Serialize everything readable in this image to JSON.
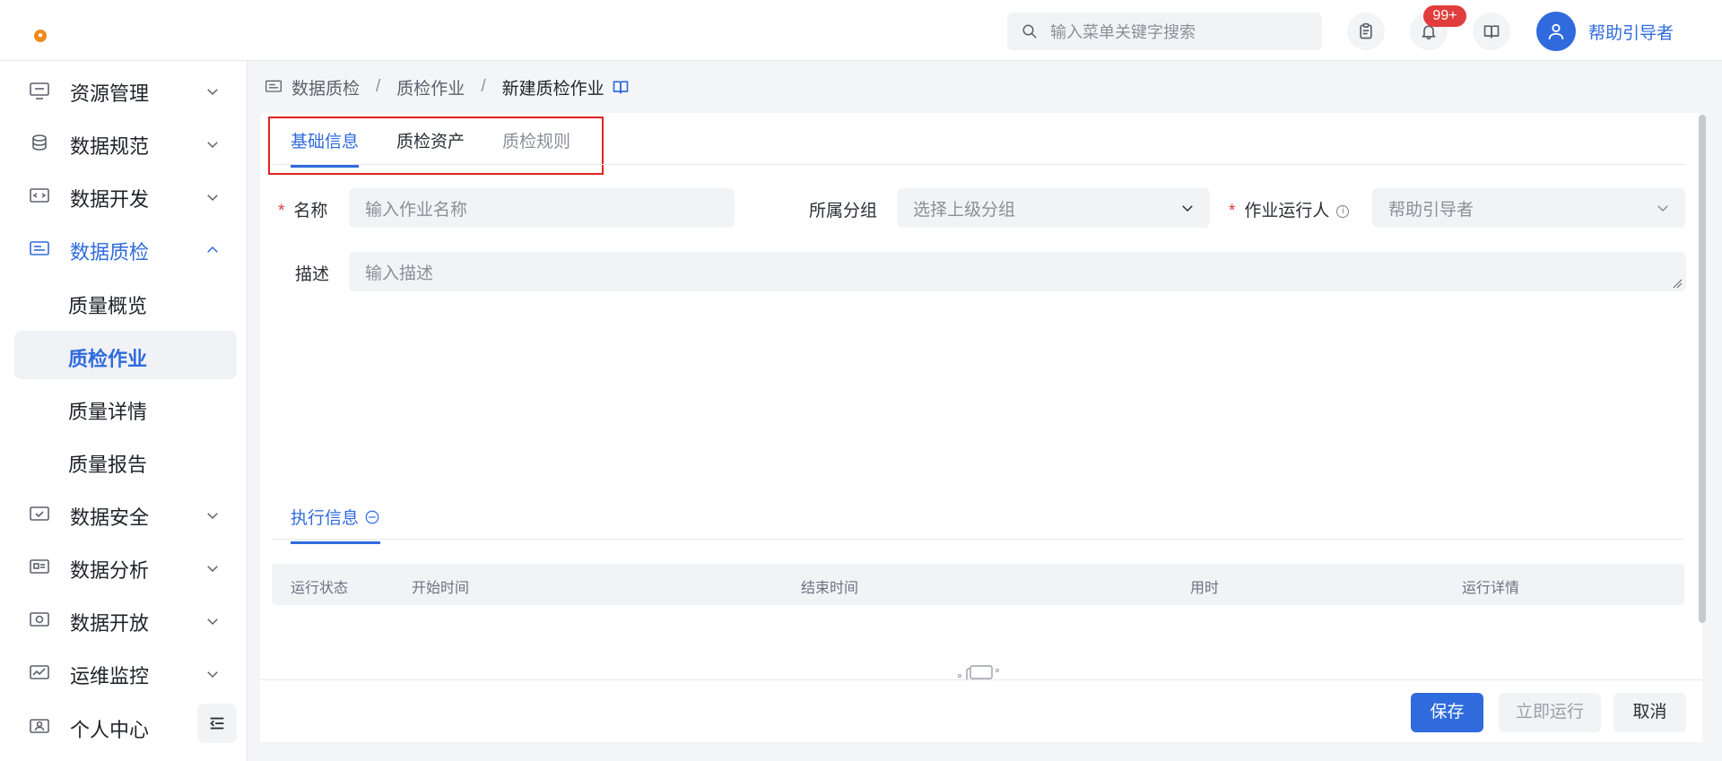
{
  "header": {
    "search_placeholder": "输入菜单关键字搜索",
    "notification_badge": "99+",
    "username": "帮助引导者"
  },
  "sidebar": {
    "items": [
      {
        "label": "资源管理"
      },
      {
        "label": "数据规范"
      },
      {
        "label": "数据开发"
      },
      {
        "label": "数据质检"
      },
      {
        "label": "数据安全"
      },
      {
        "label": "数据分析"
      },
      {
        "label": "数据开放"
      },
      {
        "label": "运维监控"
      },
      {
        "label": "个人中心"
      }
    ],
    "subitems": [
      {
        "label": "质量概览"
      },
      {
        "label": "质检作业"
      },
      {
        "label": "质量详情"
      },
      {
        "label": "质量报告"
      }
    ]
  },
  "breadcrumb": {
    "items": [
      "数据质检",
      "质检作业",
      "新建质检作业"
    ],
    "separator": "/"
  },
  "tabs": {
    "basic": "基础信息",
    "assets": "质检资产",
    "rules": "质检规则"
  },
  "form": {
    "required_mark": "*",
    "name_label": "名称",
    "name_placeholder": "输入作业名称",
    "group_label": "所属分组",
    "group_placeholder": "选择上级分组",
    "runner_label": "作业运行人",
    "runner_value": "帮助引导者",
    "desc_label": "描述",
    "desc_placeholder": "输入描述"
  },
  "exec": {
    "tab_label": "执行信息",
    "columns": [
      "运行状态",
      "开始时间",
      "结束时间",
      "用时",
      "运行详情"
    ]
  },
  "footer": {
    "save": "保存",
    "run_now": "立即运行",
    "cancel": "取消"
  },
  "colors": {
    "accent": "#2f6bdc",
    "danger": "#e23c3c",
    "highlight_box": "#e12222"
  }
}
